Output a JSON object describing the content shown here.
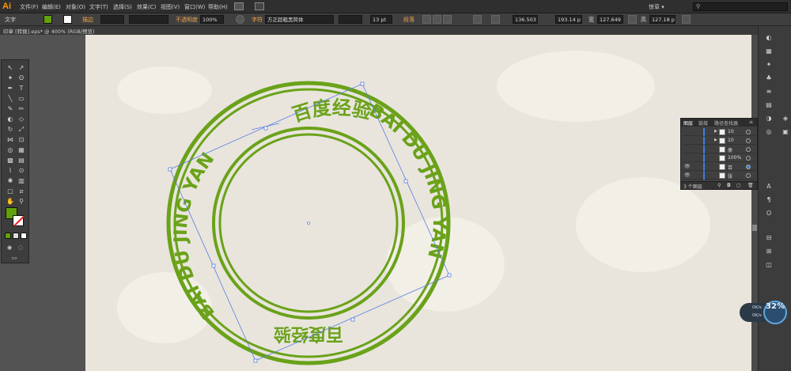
{
  "app": {
    "logo": "Ai"
  },
  "menu": [
    "文件(F)",
    "编辑(E)",
    "对象(O)",
    "文字(T)",
    "选择(S)",
    "效果(C)",
    "视图(V)",
    "窗口(W)",
    "帮助(H)"
  ],
  "workspace": {
    "label": "惊草 ▾"
  },
  "control": {
    "type_label": "文字",
    "stroke_label": "描边",
    "opacity_label": "不透明度",
    "opacity_value": "100%",
    "char_label": "字符",
    "font_value": "方正超粗黑简体",
    "font_size_value": "13 pt",
    "para_label": "段落",
    "x_value": "136.503",
    "y_value": "193.14 p",
    "w_label": "宽",
    "w_value": "127.649",
    "h_label": "高",
    "h_value": "127.18 p"
  },
  "document": {
    "tab": "印章 [转换].eps* @ 400% (RGB/预览)"
  },
  "seal": {
    "top_chinese": "百度经验",
    "bottom_chinese": "百度经验",
    "english_left": "BAI DU JING YAN",
    "english_right": "BAI DU JING YAN",
    "color": "#6aa219"
  },
  "layers_panel": {
    "tabs": [
      "图层",
      "链接",
      "路径查找器"
    ],
    "rows": [
      {
        "name": "10",
        "expand": "▶"
      },
      {
        "name": "10",
        "expand": "▶"
      },
      {
        "name": "册",
        "expand": ""
      },
      {
        "name": "100%",
        "expand": ""
      },
      {
        "name": "百",
        "expand": ""
      },
      {
        "name": "张",
        "expand": ""
      }
    ],
    "footer": "3 个图层"
  },
  "network": {
    "up": "0K/s",
    "down": "0K/s",
    "percent": "32%"
  },
  "colors": {
    "fill": "#63a10a",
    "canvas": "#e9e5dd"
  }
}
